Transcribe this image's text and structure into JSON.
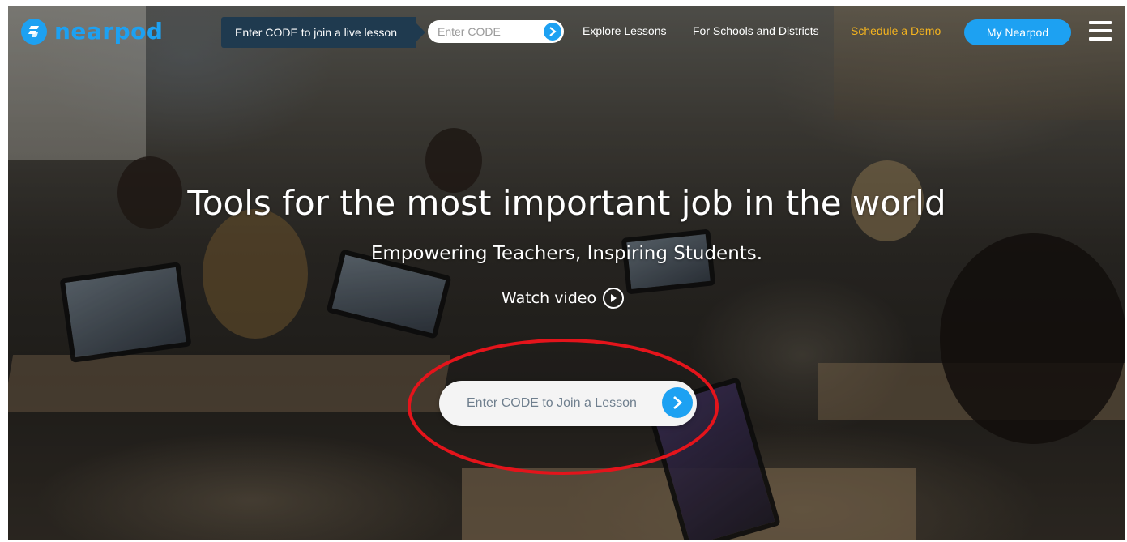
{
  "brand": {
    "name": "nearpod",
    "accent_color": "#1da1f2",
    "icon": "nearpod-logo-icon"
  },
  "header": {
    "join_label": "Enter CODE to join a live lesson",
    "code_placeholder": "Enter CODE",
    "go_icon": "chevron-right-icon",
    "nav": {
      "explore": "Explore Lessons",
      "schools": "For Schools and Districts",
      "demo": "Schedule a Demo",
      "demo_color": "#f5b41f"
    },
    "my_nearpod": "My Nearpod",
    "menu_icon": "hamburger-menu-icon"
  },
  "hero": {
    "headline": "Tools for the most important job in the world",
    "subhead": "Empowering Teachers, Inspiring Students.",
    "watch_video": "Watch video",
    "play_icon": "play-circle-icon",
    "join_placeholder": "Enter CODE to Join a Lesson",
    "annotation_color": "#e4141b"
  }
}
